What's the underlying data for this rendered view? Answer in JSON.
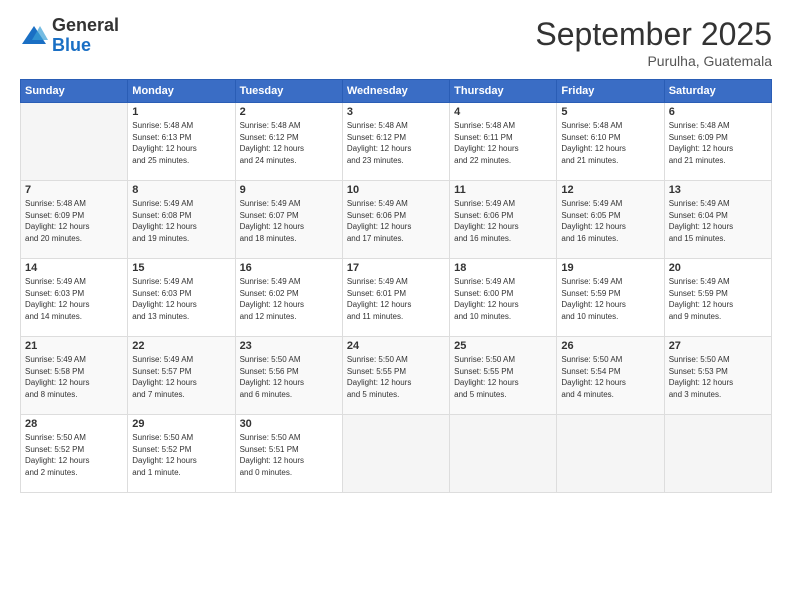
{
  "logo": {
    "general": "General",
    "blue": "Blue"
  },
  "title": "September 2025",
  "location": "Purulha, Guatemala",
  "headers": [
    "Sunday",
    "Monday",
    "Tuesday",
    "Wednesday",
    "Thursday",
    "Friday",
    "Saturday"
  ],
  "weeks": [
    [
      {
        "num": "",
        "info": ""
      },
      {
        "num": "1",
        "info": "Sunrise: 5:48 AM\nSunset: 6:13 PM\nDaylight: 12 hours\nand 25 minutes."
      },
      {
        "num": "2",
        "info": "Sunrise: 5:48 AM\nSunset: 6:12 PM\nDaylight: 12 hours\nand 24 minutes."
      },
      {
        "num": "3",
        "info": "Sunrise: 5:48 AM\nSunset: 6:12 PM\nDaylight: 12 hours\nand 23 minutes."
      },
      {
        "num": "4",
        "info": "Sunrise: 5:48 AM\nSunset: 6:11 PM\nDaylight: 12 hours\nand 22 minutes."
      },
      {
        "num": "5",
        "info": "Sunrise: 5:48 AM\nSunset: 6:10 PM\nDaylight: 12 hours\nand 21 minutes."
      },
      {
        "num": "6",
        "info": "Sunrise: 5:48 AM\nSunset: 6:09 PM\nDaylight: 12 hours\nand 21 minutes."
      }
    ],
    [
      {
        "num": "7",
        "info": "Sunrise: 5:48 AM\nSunset: 6:09 PM\nDaylight: 12 hours\nand 20 minutes."
      },
      {
        "num": "8",
        "info": "Sunrise: 5:49 AM\nSunset: 6:08 PM\nDaylight: 12 hours\nand 19 minutes."
      },
      {
        "num": "9",
        "info": "Sunrise: 5:49 AM\nSunset: 6:07 PM\nDaylight: 12 hours\nand 18 minutes."
      },
      {
        "num": "10",
        "info": "Sunrise: 5:49 AM\nSunset: 6:06 PM\nDaylight: 12 hours\nand 17 minutes."
      },
      {
        "num": "11",
        "info": "Sunrise: 5:49 AM\nSunset: 6:06 PM\nDaylight: 12 hours\nand 16 minutes."
      },
      {
        "num": "12",
        "info": "Sunrise: 5:49 AM\nSunset: 6:05 PM\nDaylight: 12 hours\nand 16 minutes."
      },
      {
        "num": "13",
        "info": "Sunrise: 5:49 AM\nSunset: 6:04 PM\nDaylight: 12 hours\nand 15 minutes."
      }
    ],
    [
      {
        "num": "14",
        "info": "Sunrise: 5:49 AM\nSunset: 6:03 PM\nDaylight: 12 hours\nand 14 minutes."
      },
      {
        "num": "15",
        "info": "Sunrise: 5:49 AM\nSunset: 6:03 PM\nDaylight: 12 hours\nand 13 minutes."
      },
      {
        "num": "16",
        "info": "Sunrise: 5:49 AM\nSunset: 6:02 PM\nDaylight: 12 hours\nand 12 minutes."
      },
      {
        "num": "17",
        "info": "Sunrise: 5:49 AM\nSunset: 6:01 PM\nDaylight: 12 hours\nand 11 minutes."
      },
      {
        "num": "18",
        "info": "Sunrise: 5:49 AM\nSunset: 6:00 PM\nDaylight: 12 hours\nand 10 minutes."
      },
      {
        "num": "19",
        "info": "Sunrise: 5:49 AM\nSunset: 5:59 PM\nDaylight: 12 hours\nand 10 minutes."
      },
      {
        "num": "20",
        "info": "Sunrise: 5:49 AM\nSunset: 5:59 PM\nDaylight: 12 hours\nand 9 minutes."
      }
    ],
    [
      {
        "num": "21",
        "info": "Sunrise: 5:49 AM\nSunset: 5:58 PM\nDaylight: 12 hours\nand 8 minutes."
      },
      {
        "num": "22",
        "info": "Sunrise: 5:49 AM\nSunset: 5:57 PM\nDaylight: 12 hours\nand 7 minutes."
      },
      {
        "num": "23",
        "info": "Sunrise: 5:50 AM\nSunset: 5:56 PM\nDaylight: 12 hours\nand 6 minutes."
      },
      {
        "num": "24",
        "info": "Sunrise: 5:50 AM\nSunset: 5:55 PM\nDaylight: 12 hours\nand 5 minutes."
      },
      {
        "num": "25",
        "info": "Sunrise: 5:50 AM\nSunset: 5:55 PM\nDaylight: 12 hours\nand 5 minutes."
      },
      {
        "num": "26",
        "info": "Sunrise: 5:50 AM\nSunset: 5:54 PM\nDaylight: 12 hours\nand 4 minutes."
      },
      {
        "num": "27",
        "info": "Sunrise: 5:50 AM\nSunset: 5:53 PM\nDaylight: 12 hours\nand 3 minutes."
      }
    ],
    [
      {
        "num": "28",
        "info": "Sunrise: 5:50 AM\nSunset: 5:52 PM\nDaylight: 12 hours\nand 2 minutes."
      },
      {
        "num": "29",
        "info": "Sunrise: 5:50 AM\nSunset: 5:52 PM\nDaylight: 12 hours\nand 1 minute."
      },
      {
        "num": "30",
        "info": "Sunrise: 5:50 AM\nSunset: 5:51 PM\nDaylight: 12 hours\nand 0 minutes."
      },
      {
        "num": "",
        "info": ""
      },
      {
        "num": "",
        "info": ""
      },
      {
        "num": "",
        "info": ""
      },
      {
        "num": "",
        "info": ""
      }
    ]
  ]
}
